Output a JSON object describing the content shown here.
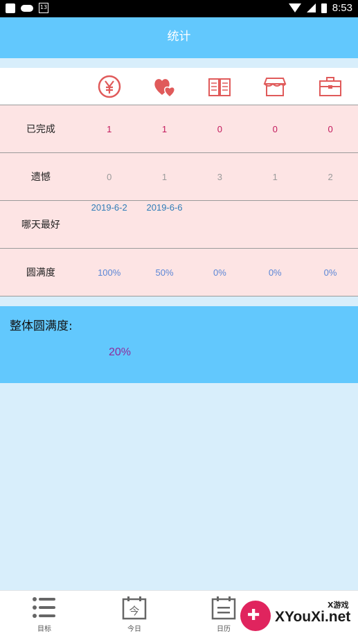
{
  "status_bar": {
    "notification_number": "13",
    "time": "8:53"
  },
  "header": {
    "title": "统计"
  },
  "table": {
    "icons": [
      "yen-icon",
      "hearts-icon",
      "book-icon",
      "shop-icon",
      "briefcase-icon"
    ],
    "rows": [
      {
        "label": "已完成",
        "values": [
          "1",
          "1",
          "0",
          "0",
          "0"
        ]
      },
      {
        "label": "遗憾",
        "values": [
          "0",
          "1",
          "3",
          "1",
          "2"
        ]
      },
      {
        "label": "哪天最好",
        "values": [
          "2019-6-2",
          "2019-6-6",
          "",
          "",
          ""
        ]
      },
      {
        "label": "圆满度",
        "values": [
          "100%",
          "50%",
          "0%",
          "0%",
          "0%"
        ]
      }
    ]
  },
  "summary": {
    "title": "整体圆满度:",
    "value": "20%"
  },
  "bottom_nav": {
    "tabs": [
      {
        "label": "目标",
        "icon": "list-icon"
      },
      {
        "label": "今日",
        "icon": "today-calendar-icon"
      },
      {
        "label": "日历",
        "icon": "calendar-icon"
      }
    ]
  },
  "watermark": {
    "small_text": "X游戏",
    "brand_text": "XYouXi.net"
  },
  "colors": {
    "app_bar": "#62c8fd",
    "background": "#d8eefb",
    "row_pink": "#fde4e4",
    "icon_red": "#e05a5a"
  }
}
